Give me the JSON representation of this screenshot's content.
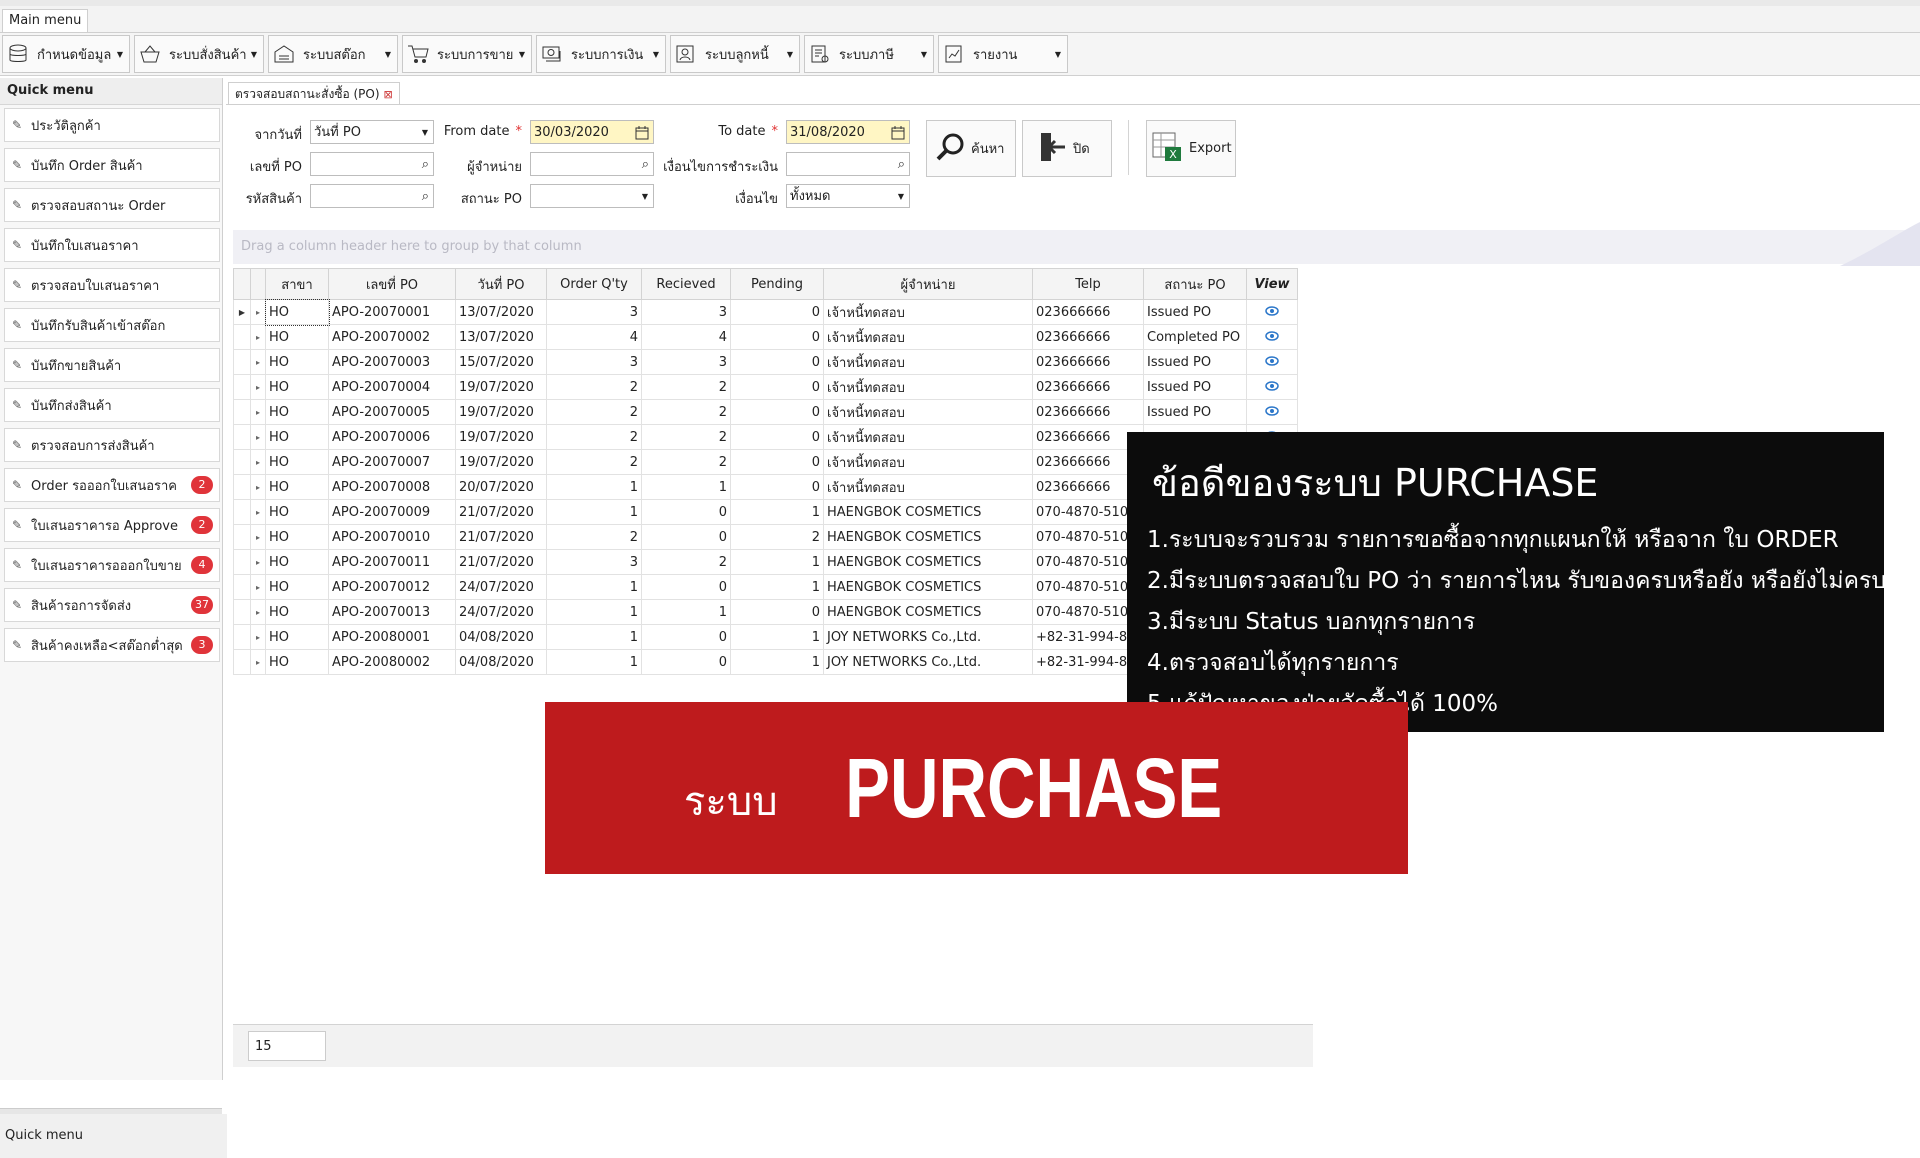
{
  "main_tab": "Main menu",
  "toolbar": [
    {
      "label": "กำหนดข้อมูล",
      "icon": "database-icon"
    },
    {
      "label": "ระบบสั่งสินค้า",
      "icon": "basket-icon"
    },
    {
      "label": "ระบบสต๊อก",
      "icon": "warehouse-icon"
    },
    {
      "label": "ระบบการขาย",
      "icon": "cart-icon"
    },
    {
      "label": "ระบบการเงิน",
      "icon": "money-icon"
    },
    {
      "label": "ระบบลูกหนี้",
      "icon": "debtor-icon"
    },
    {
      "label": "ระบบภาษี",
      "icon": "tax-icon"
    },
    {
      "label": "รายงาน",
      "icon": "report-icon"
    }
  ],
  "sidebar": {
    "title": "Quick menu",
    "items": [
      {
        "label": "ประวัติลูกค้า",
        "badge": ""
      },
      {
        "label": "บันทึก Order สินค้า",
        "badge": ""
      },
      {
        "label": "ตรวจสอบสถานะ Order",
        "badge": ""
      },
      {
        "label": "บันทึกใบเสนอราคา",
        "badge": ""
      },
      {
        "label": "ตรวจสอบใบเสนอราคา",
        "badge": ""
      },
      {
        "label": "บันทึกรับสินค้าเข้าสต๊อก",
        "badge": ""
      },
      {
        "label": "บันทึกขายสินค้า",
        "badge": ""
      },
      {
        "label": "บันทึกส่งสินค้า",
        "badge": ""
      },
      {
        "label": "ตรวจสอบการส่งสินค้า",
        "badge": ""
      },
      {
        "label": "Order รอออกใบเสนอราค",
        "badge": "2"
      },
      {
        "label": "ใบเสนอราคารอ Approve",
        "badge": "2"
      },
      {
        "label": "ใบเสนอราคารอออกใบขาย",
        "badge": "4"
      },
      {
        "label": "สินค้ารอการจัดส่ง",
        "badge": "37"
      },
      {
        "label": "สินค้าคงเหลือ<สต๊อกต่ำสุด",
        "badge": "3"
      }
    ],
    "footer": "Quick menu"
  },
  "doc_tab": {
    "label": "ตรวจสอบสถานะสั่งซื้อ (PO)",
    "close": "⊠"
  },
  "filters": {
    "date_type_label": "จากวันที่",
    "date_type_value": "วันที่ PO",
    "from_date_label": "From date",
    "from_date_value": "30/03/2020",
    "to_date_label": "To date",
    "to_date_value": "31/08/2020",
    "po_no_label": "เลขที่ PO",
    "supplier_label": "ผู้จำหน่าย",
    "payment_cond_label": "เงื่อนไขการชำระเงิน",
    "product_code_label": "รหัสสินค้า",
    "po_status_label": "สถานะ PO",
    "condition_label": "เงื่อนไข",
    "condition_value": "ทั้งหมด",
    "required_mark": "*"
  },
  "actions": {
    "search": "ค้นหา",
    "close": "ปิด",
    "export": "Export"
  },
  "group_hint": "Drag a column header here to group by that column",
  "columns": [
    "สาขา",
    "เลขที่ PO",
    "วันที่ PO",
    "Order Q'ty",
    "Recieved",
    "Pending",
    "ผู้จำหน่าย",
    "Telp",
    "สถานะ PO",
    "View"
  ],
  "rows": [
    [
      "HO",
      "APO-20070001",
      "13/07/2020",
      "3",
      "3",
      "0",
      "เจ้าหนี้ทดสอบ",
      "023666666",
      "Issued PO"
    ],
    [
      "HO",
      "APO-20070002",
      "13/07/2020",
      "4",
      "4",
      "0",
      "เจ้าหนี้ทดสอบ",
      "023666666",
      "Completed PO"
    ],
    [
      "HO",
      "APO-20070003",
      "15/07/2020",
      "3",
      "3",
      "0",
      "เจ้าหนี้ทดสอบ",
      "023666666",
      "Issued PO"
    ],
    [
      "HO",
      "APO-20070004",
      "19/07/2020",
      "2",
      "2",
      "0",
      "เจ้าหนี้ทดสอบ",
      "023666666",
      "Issued PO"
    ],
    [
      "HO",
      "APO-20070005",
      "19/07/2020",
      "2",
      "2",
      "0",
      "เจ้าหนี้ทดสอบ",
      "023666666",
      "Issued PO"
    ],
    [
      "HO",
      "APO-20070006",
      "19/07/2020",
      "2",
      "2",
      "0",
      "เจ้าหนี้ทดสอบ",
      "023666666",
      ""
    ],
    [
      "HO",
      "APO-20070007",
      "19/07/2020",
      "2",
      "2",
      "0",
      "เจ้าหนี้ทดสอบ",
      "023666666",
      ""
    ],
    [
      "HO",
      "APO-20070008",
      "20/07/2020",
      "1",
      "1",
      "0",
      "เจ้าหนี้ทดสอบ",
      "023666666",
      ""
    ],
    [
      "HO",
      "APO-20070009",
      "21/07/2020",
      "1",
      "0",
      "1",
      "HAENGBOK COSMETICS",
      "070-4870-510",
      ""
    ],
    [
      "HO",
      "APO-20070010",
      "21/07/2020",
      "2",
      "0",
      "2",
      "HAENGBOK COSMETICS",
      "070-4870-510",
      ""
    ],
    [
      "HO",
      "APO-20070011",
      "21/07/2020",
      "3",
      "2",
      "1",
      "HAENGBOK COSMETICS",
      "070-4870-510",
      ""
    ],
    [
      "HO",
      "APO-20070012",
      "24/07/2020",
      "1",
      "0",
      "1",
      "HAENGBOK COSMETICS",
      "070-4870-510",
      ""
    ],
    [
      "HO",
      "APO-20070013",
      "24/07/2020",
      "1",
      "1",
      "0",
      "HAENGBOK COSMETICS",
      "070-4870-510",
      ""
    ],
    [
      "HO",
      "APO-20080001",
      "04/08/2020",
      "1",
      "0",
      "1",
      "JOY NETWORKS Co.,Ltd.",
      "+82-31-994-8",
      ""
    ],
    [
      "HO",
      "APO-20080002",
      "04/08/2020",
      "1",
      "0",
      "1",
      "JOY NETWORKS Co.,Ltd.",
      "+82-31-994-8",
      ""
    ]
  ],
  "row_count": "15",
  "overlay": {
    "title": "ข้อดีของระบบ PURCHASE",
    "points": [
      "1.ระบบจะรวบรวม รายการขอซื้อจากทุกแผนกให้ หรือจาก ใบ ORDER",
      "2.มีระบบตรวจสอบใบ PO ว่า รายการไหน รับของครบหรือยัง หรือยังไม่ครบ",
      "3.มีระบบ Status บอกทุกรายการ",
      "4.ตรวจสอบได้ทุกรายการ",
      "5.แก้ปัญหาของฝ่ายจัดซื้อได้  100%"
    ]
  },
  "banner": {
    "prefix": "ระบบ",
    "main": "PURCHASE"
  },
  "colors": {
    "badge": "#e0343a",
    "banner": "#be1b1d",
    "overlay_bg": "#0c0c0c",
    "date_field": "#fff6c4",
    "view_icon": "#2a76c9"
  }
}
